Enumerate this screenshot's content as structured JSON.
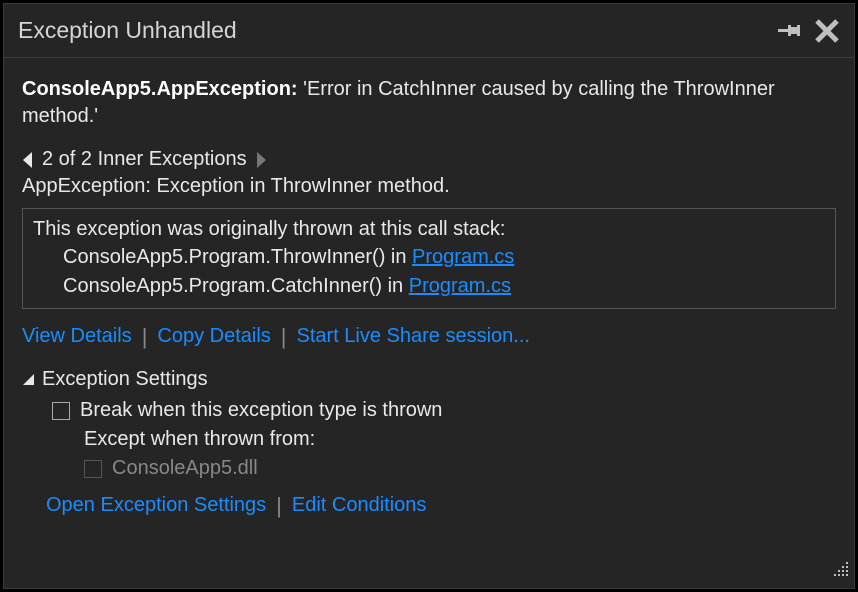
{
  "titlebar": {
    "title": "Exception Unhandled"
  },
  "exception": {
    "type": "ConsoleApp5.AppException:",
    "message": "'Error in CatchInner caused by calling the ThrowInner method.'"
  },
  "inner_nav": {
    "position_text": "2 of 2 Inner Exceptions",
    "detail": "AppException: Exception in ThrowInner method."
  },
  "call_stack": {
    "intro": "This exception was originally thrown at this call stack:",
    "frames": [
      {
        "method": "ConsoleApp5.Program.ThrowInner() in ",
        "file": "Program.cs"
      },
      {
        "method": "ConsoleApp5.Program.CatchInner() in ",
        "file": "Program.cs"
      }
    ]
  },
  "actions": {
    "view_details": "View Details",
    "copy_details": "Copy Details",
    "start_live_share": "Start Live Share session..."
  },
  "exception_settings": {
    "header": "Exception Settings",
    "break_when_thrown": "Break when this exception type is thrown",
    "except_when": "Except when thrown from:",
    "module": "ConsoleApp5.dll",
    "open_settings": "Open Exception Settings",
    "edit_conditions": "Edit Conditions"
  }
}
